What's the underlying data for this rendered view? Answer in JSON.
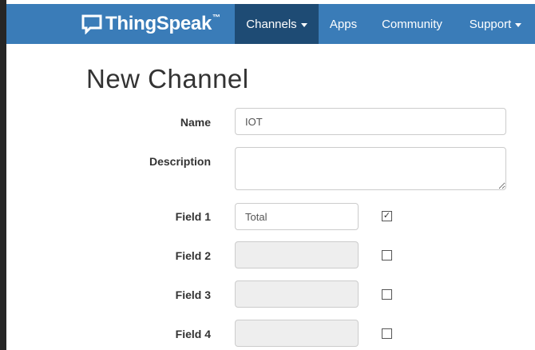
{
  "navbar": {
    "brand": "ThingSpeak",
    "trademark": "™",
    "items": [
      {
        "label": "Channels",
        "has_dropdown": true,
        "active": true
      },
      {
        "label": "Apps",
        "has_dropdown": false,
        "active": false
      },
      {
        "label": "Community",
        "has_dropdown": false,
        "active": false
      },
      {
        "label": "Support",
        "has_dropdown": true,
        "active": false
      }
    ]
  },
  "page": {
    "title": "New Channel"
  },
  "form": {
    "name": {
      "label": "Name",
      "value": "IOT"
    },
    "description": {
      "label": "Description",
      "value": ""
    },
    "fields": [
      {
        "label": "Field 1",
        "value": "Total",
        "enabled": true,
        "checked": true
      },
      {
        "label": "Field 2",
        "value": "",
        "enabled": false,
        "checked": false
      },
      {
        "label": "Field 3",
        "value": "",
        "enabled": false,
        "checked": false
      },
      {
        "label": "Field 4",
        "value": "",
        "enabled": false,
        "checked": false
      }
    ],
    "check_mark": "✓"
  },
  "icons": {
    "brand_logo": "speech-bubble-icon",
    "dropdown": "caret-down-icon"
  },
  "colors": {
    "navbar": "#3a7cb8",
    "navbar_active": "#1e4b74",
    "disabled_input": "#eeeeee"
  }
}
